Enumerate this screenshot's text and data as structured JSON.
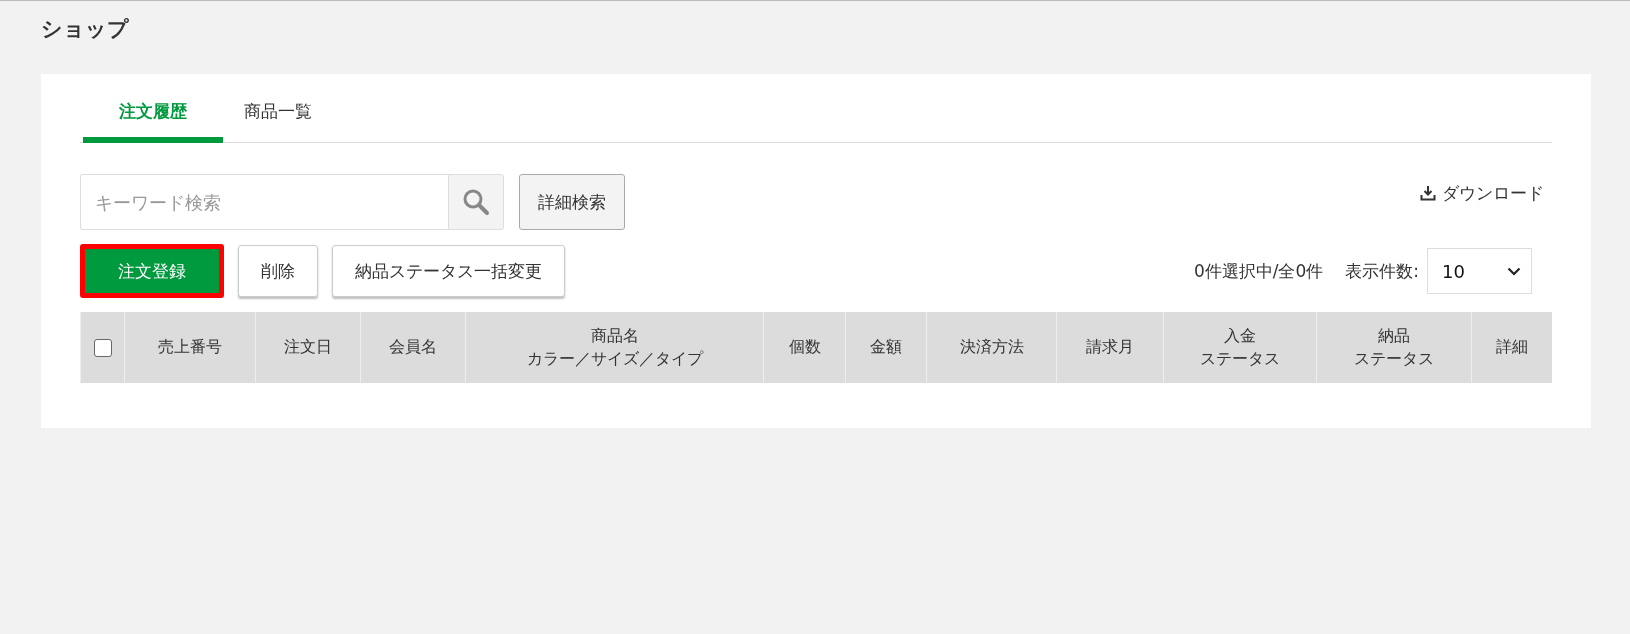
{
  "page_title": "ショップ",
  "tabs": [
    {
      "label": "注文履歴",
      "selected": true
    },
    {
      "label": "商品一覧",
      "selected": false
    }
  ],
  "search": {
    "placeholder": "キーワード検索",
    "advanced_button": "詳細検索"
  },
  "download": "ダウンロード",
  "actions": [
    {
      "label": "注文登録",
      "kind": "primary",
      "highlighted": true
    },
    {
      "label": "削除",
      "kind": "default",
      "highlighted": false
    },
    {
      "label": "納品ステータス一括変更",
      "kind": "default",
      "highlighted": false
    }
  ],
  "selection_count": "0件選択中/全0件",
  "page_size": {
    "label": "表示件数:",
    "value": "10"
  },
  "table": {
    "select_all": {
      "checked": false
    },
    "columns": [
      [
        "売上番号"
      ],
      [
        "注文日"
      ],
      [
        "会員名"
      ],
      [
        "商品名",
        "カラー／サイズ／タイプ"
      ],
      [
        "個数"
      ],
      [
        "金額"
      ],
      [
        "決済方法"
      ],
      [
        "請求月"
      ],
      [
        "入金",
        "ステータス"
      ],
      [
        "納品",
        "ステータス"
      ],
      [
        "詳細"
      ]
    ]
  }
}
